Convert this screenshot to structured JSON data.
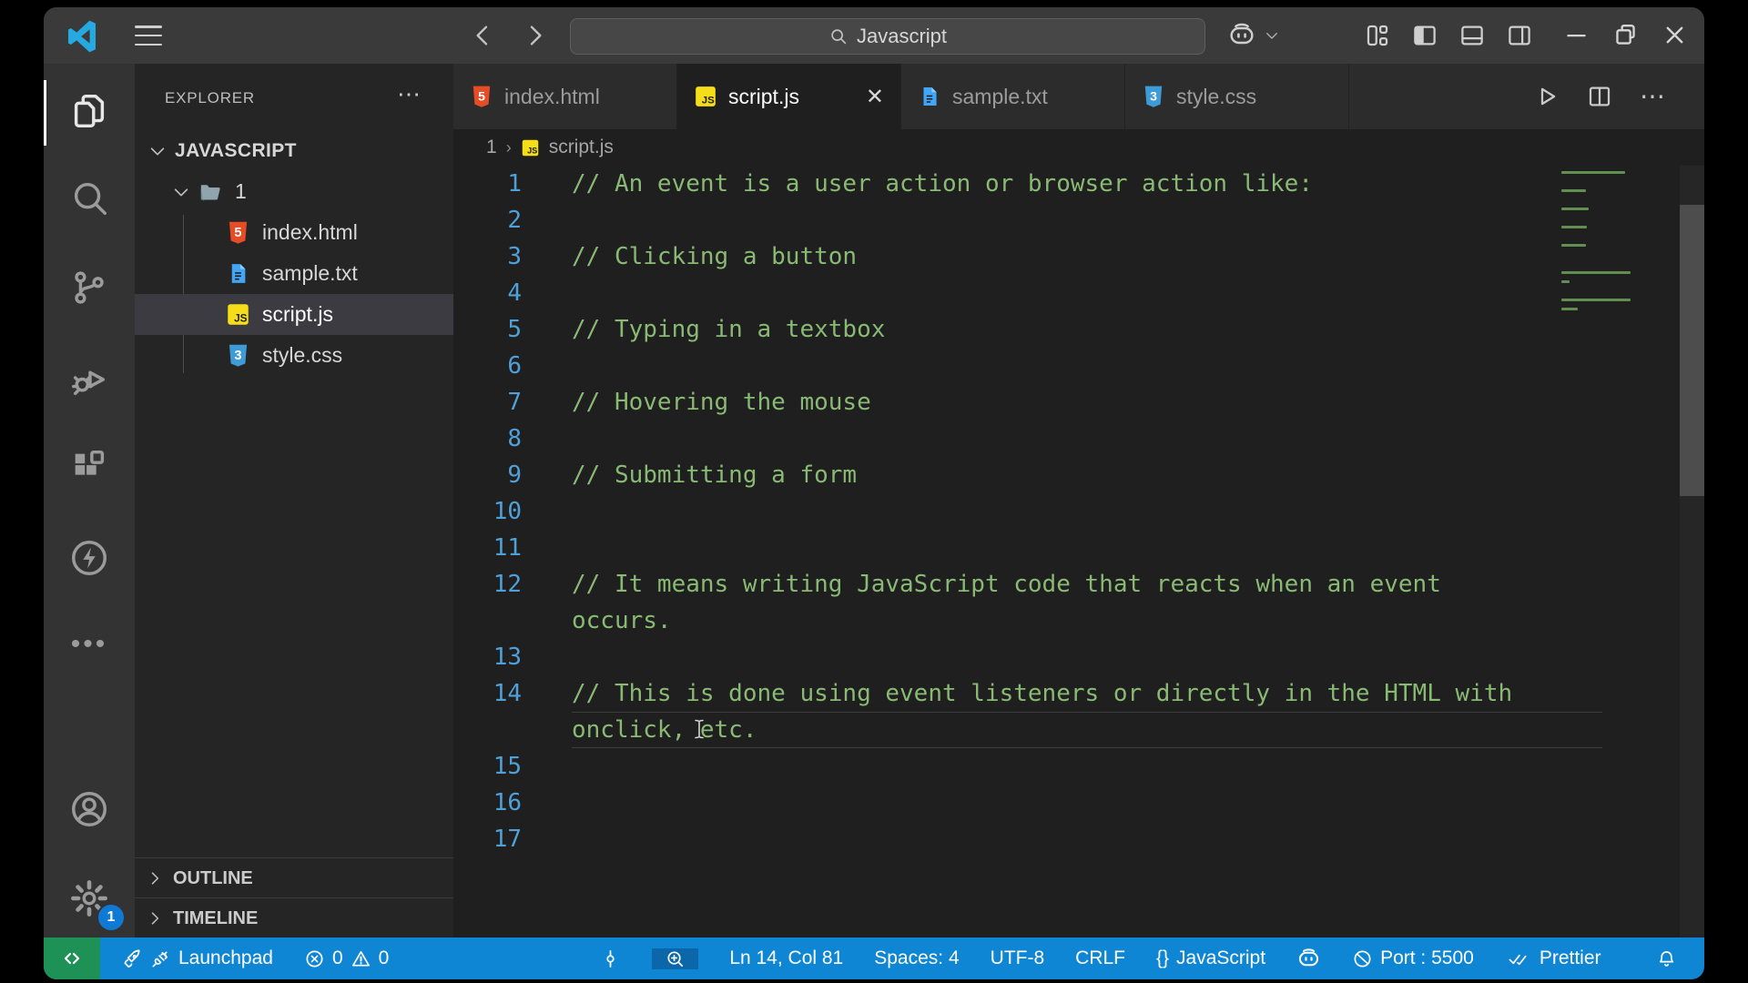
{
  "titlebar": {
    "search_value": "Javascript"
  },
  "activity_bar": {
    "settings_badge": "1"
  },
  "sidebar": {
    "header": "EXPLORER",
    "root_label": "JAVASCRIPT",
    "folder_label": "1",
    "files": [
      {
        "name": "index.html",
        "icon": "html",
        "selected": false
      },
      {
        "name": "sample.txt",
        "icon": "txt",
        "selected": false
      },
      {
        "name": "script.js",
        "icon": "js",
        "selected": true
      },
      {
        "name": "style.css",
        "icon": "css",
        "selected": false
      }
    ],
    "outline_label": "OUTLINE",
    "timeline_label": "TIMELINE"
  },
  "editor": {
    "tabs": [
      {
        "label": "index.html",
        "icon": "html",
        "active": false
      },
      {
        "label": "script.js",
        "icon": "js",
        "active": true
      },
      {
        "label": "sample.txt",
        "icon": "txt",
        "active": false
      },
      {
        "label": "style.css",
        "icon": "css",
        "active": false
      }
    ],
    "breadcrumb": {
      "folder": "1",
      "file": "script.js"
    },
    "code_rows": [
      {
        "num": "1",
        "text": "// An event is a user action or browser action like:"
      },
      {
        "num": "2",
        "text": ""
      },
      {
        "num": "3",
        "text": "// Clicking a button"
      },
      {
        "num": "4",
        "text": ""
      },
      {
        "num": "5",
        "text": "// Typing in a textbox"
      },
      {
        "num": "6",
        "text": ""
      },
      {
        "num": "7",
        "text": "// Hovering the mouse"
      },
      {
        "num": "8",
        "text": ""
      },
      {
        "num": "9",
        "text": "// Submitting a form"
      },
      {
        "num": "10",
        "text": ""
      },
      {
        "num": "11",
        "text": ""
      },
      {
        "num": "12",
        "text": "// It means writing JavaScript code that reacts when an event"
      },
      {
        "num": "",
        "text": "occurs."
      },
      {
        "num": "13",
        "text": ""
      },
      {
        "num": "14",
        "text": "// This is done using event listeners or directly in the HTML with"
      },
      {
        "num": "",
        "text": "onclick, etc.",
        "current": true
      },
      {
        "num": "15",
        "text": ""
      },
      {
        "num": "16",
        "text": ""
      },
      {
        "num": "17",
        "text": ""
      }
    ]
  },
  "statusbar": {
    "launchpad": "Launchpad",
    "errors": "0",
    "warnings": "0",
    "cursor_position": "Ln 14, Col 81",
    "indentation": "Spaces: 4",
    "encoding": "UTF-8",
    "eol": "CRLF",
    "language_braces": "{}",
    "language": "JavaScript",
    "port": "Port : 5500",
    "formatter": "Prettier"
  },
  "colors": {
    "statusbar_blue": "#0f86d3",
    "remote_green": "#1d9156",
    "comment_green": "#89ba74",
    "line_number_blue": "#4fa0d8",
    "js_yellow": "#f5de19",
    "html_orange": "#e44d26",
    "file_blue": "#42a5f5"
  }
}
